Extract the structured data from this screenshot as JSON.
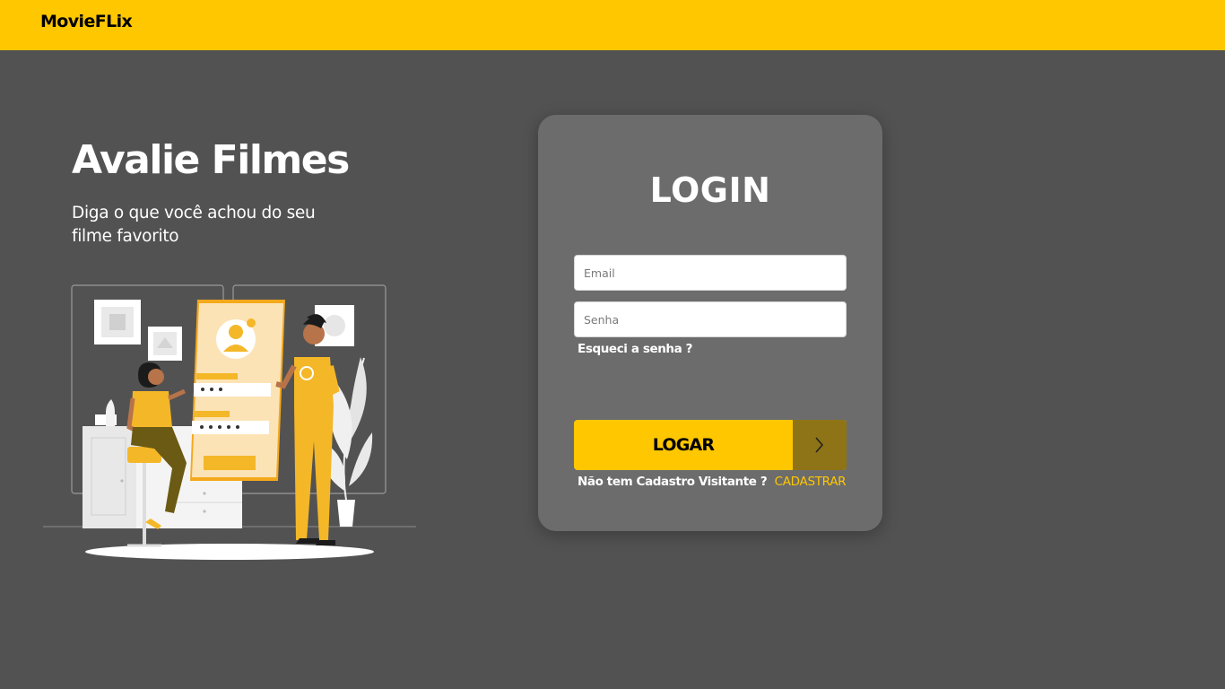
{
  "navbar": {
    "brand": "MovieFLix",
    "color": "#FFC700"
  },
  "hero": {
    "title": "Avalie Filmes",
    "subtitle": "Diga o que você achou do seu filme favorito",
    "illustration_login_icon": "user-profile-icon"
  },
  "login": {
    "title": "LOGIN",
    "email_placeholder": "Email",
    "email_value": "",
    "password_placeholder": "Senha",
    "password_value": "",
    "forgot_label": "Esqueci a senha ?",
    "submit_label": "LOGAR",
    "submit_icon": "chevron-right-icon",
    "signup_prompt": "Não tem Cadastro Visitante ?",
    "signup_link": "CADASTRAR"
  },
  "colors": {
    "accent": "#FFC700",
    "background": "#525252",
    "card": "#6C6C6C",
    "button_arrow_bg": "#8E7417"
  }
}
